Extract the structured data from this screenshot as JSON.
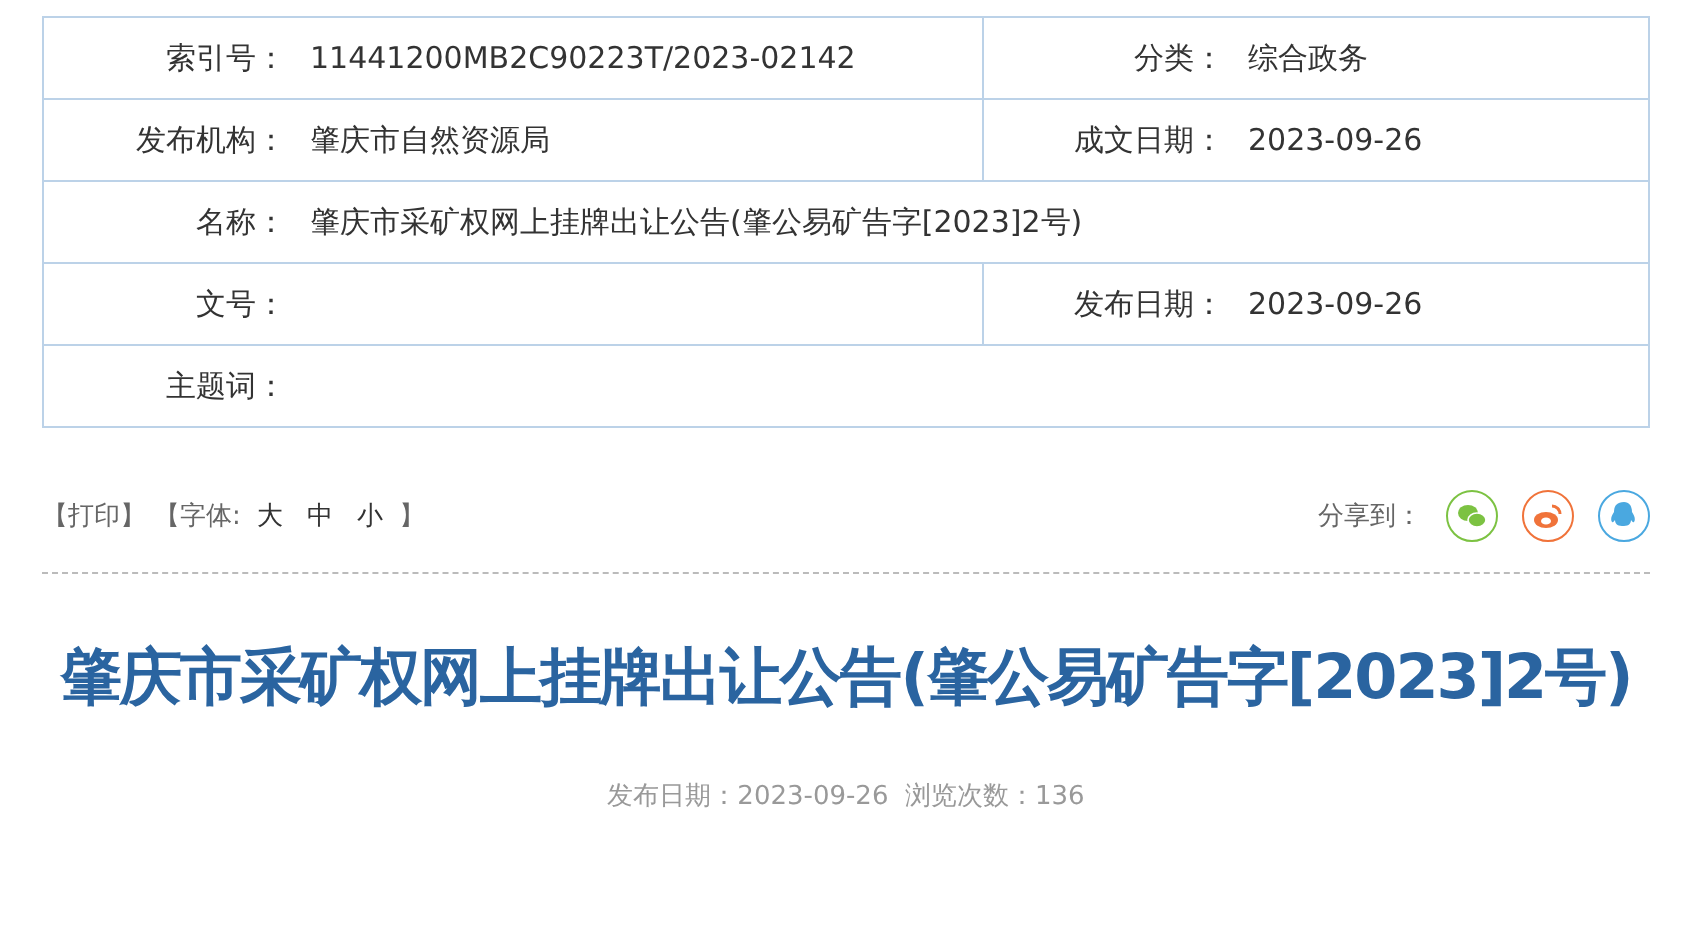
{
  "info_table": {
    "rows": [
      {
        "fields": [
          {
            "label": "索引号：",
            "value": "11441200MB2C90223T/2023-02142"
          },
          {
            "label": "分类：",
            "value": "综合政务"
          }
        ]
      },
      {
        "fields": [
          {
            "label": "发布机构：",
            "value": "肇庆市自然资源局"
          },
          {
            "label": "成文日期：",
            "value": "2023-09-26"
          }
        ]
      },
      {
        "fields": [
          {
            "label": "名称：",
            "value": "肇庆市采矿权网上挂牌出让公告(肇公易矿告字[2023]2号)"
          }
        ]
      },
      {
        "fields": [
          {
            "label": "文号："
          },
          {
            "label": "发布日期：",
            "value": "2023-09-26"
          }
        ]
      },
      {
        "fields": [
          {
            "label": "主题词："
          }
        ]
      }
    ]
  },
  "toolbar": {
    "print": "【打印】",
    "font_label": "【字体:",
    "font_sizes": [
      "大",
      "中",
      "小"
    ],
    "font_close": "】",
    "share": {
      "label": "分享到：",
      "targets": [
        {
          "kind": "wechat",
          "color": "#7cc242"
        },
        {
          "kind": "weibo",
          "color": "#f0733a"
        },
        {
          "kind": "qq",
          "color": "#4aa8e0"
        }
      ]
    }
  },
  "article": {
    "title": "肇庆市采矿权网上挂牌出让公告(肇公易矿告字[2023]2号)",
    "meta": "发布日期：2023-09-26  浏览次数：136"
  }
}
